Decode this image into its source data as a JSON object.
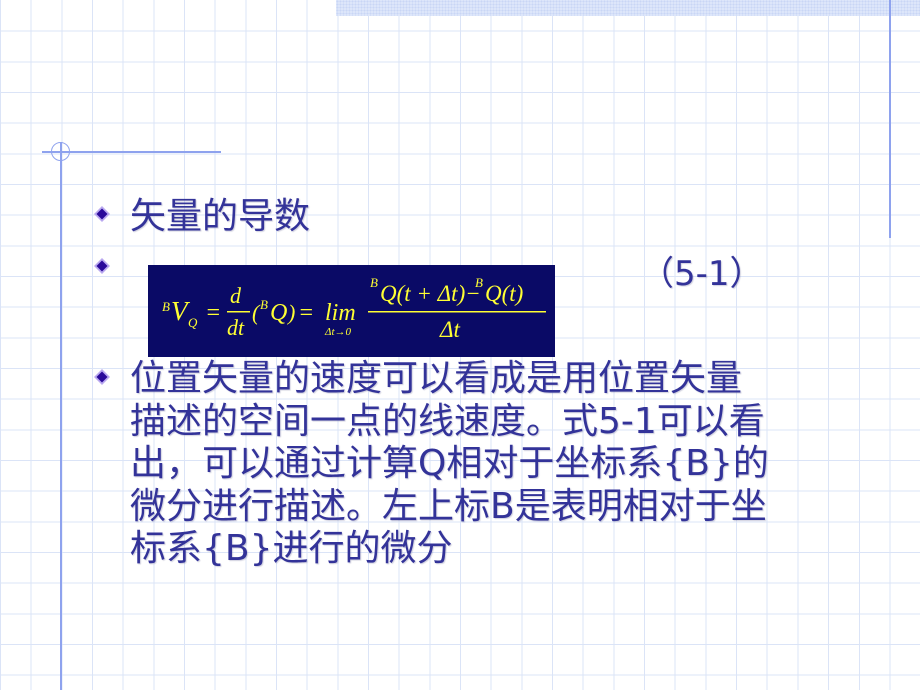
{
  "slide": {
    "heading": "矢量的导数",
    "equation_number": "（5-1）",
    "paragraph": "位置矢量的速度可以看成是用位置矢量描述的空间一点的线速度。式5-1可以看出，可以通过计算Q相对于坐标系{B}的微分进行描述。左上标B是表明相对于坐标系{B}进行的微分",
    "paragraph_lines": [
      "位置矢量的速度可以看成是用位置矢量",
      "描述的空间一点的线速度。式5-1可以看",
      "出，可以通过计算Q相对于坐标系{B}的",
      "微分进行描述。左上标B是表明相对于坐",
      "标系{B}进行的微分"
    ],
    "formula": {
      "latex": "^{B}V_{Q}=\\frac{d}{dt}(^{B}Q)=\\lim_{\\Delta t\\to 0}\\frac{^{B}Q(t+\\Delta t)-^{B}Q(t)}{\\Delta t}",
      "parts": {
        "lhs_sup": "B",
        "lhs_main": "V",
        "lhs_sub": "Q",
        "eq": "=",
        "d": "d",
        "dt": "dt",
        "paren_open": "(",
        "q_sup": "B",
        "q_main": "Q",
        "paren_close": ")",
        "lim": "lim",
        "lim_sub": "Δt→0",
        "num_sup1": "B",
        "num_part1": "Q(t + Δt)−",
        "num_sup2": "B",
        "num_part2": "Q(t)",
        "den": "Δt"
      }
    },
    "icons": {
      "bullet": "diamond-bullet-icon"
    },
    "colors": {
      "text": "#333399",
      "formula_bg": "#0a0a66",
      "formula_fg": "#ffff33",
      "grid": "#dbe4f7",
      "rule": "#8ea2ee"
    }
  }
}
